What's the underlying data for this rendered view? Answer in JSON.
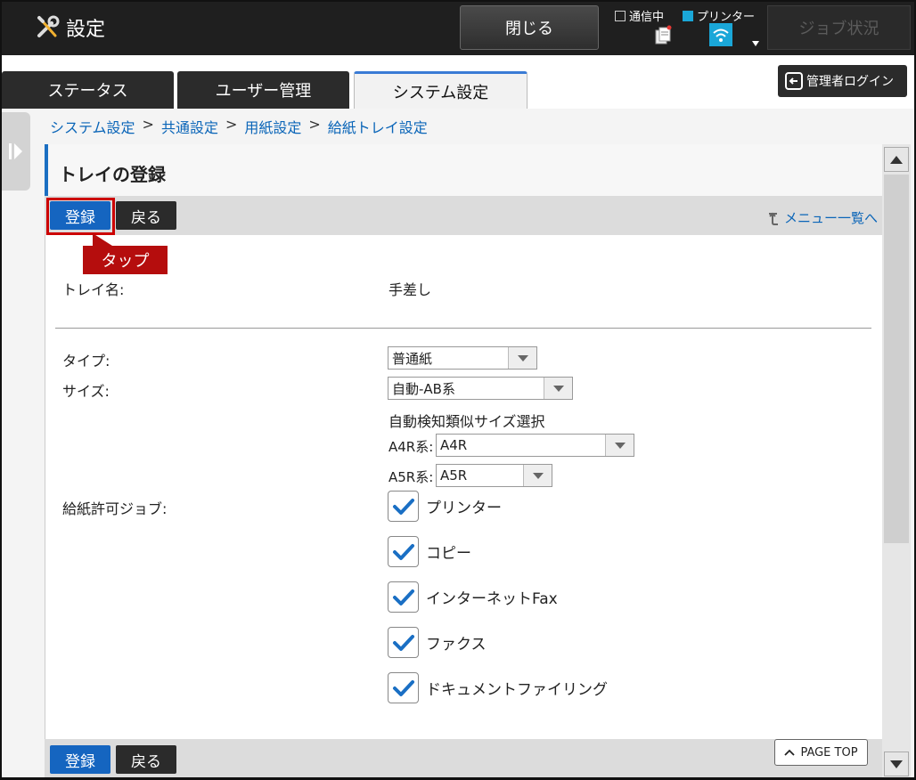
{
  "header": {
    "title": "設定",
    "close_label": "閉じる",
    "status_comm_label": "通信中",
    "status_printer_label": "プリンター",
    "job_status_label": "ジョブ状況"
  },
  "tabs": [
    {
      "label": "ステータス",
      "active": false
    },
    {
      "label": "ユーザー管理",
      "active": false
    },
    {
      "label": "システム設定",
      "active": true
    }
  ],
  "admin_login_label": "管理者ログイン",
  "breadcrumb": [
    "システム設定",
    "共通設定",
    "用紙設定",
    "給紙トレイ設定"
  ],
  "breadcrumb_sep": ">",
  "page_title": "トレイの登録",
  "toolbar": {
    "register_label": "登録",
    "back_label": "戻る",
    "menu_link_label": "メニュー一覧へ"
  },
  "tooltip_text": "タップ",
  "form": {
    "tray_name_label": "トレイ名:",
    "tray_name_value": "手差し",
    "type_label": "タイプ:",
    "type_value": "普通紙",
    "size_label": "サイズ:",
    "size_value": "自動-AB系",
    "auto_detect_label": "自動検知類似サイズ選択",
    "a4r_label": "A4R系:",
    "a4r_value": "A4R",
    "a5r_label": "A5R系:",
    "a5r_value": "A5R",
    "allowed_jobs_label": "給紙許可ジョブ:",
    "jobs": [
      {
        "label": "プリンター",
        "checked": true
      },
      {
        "label": "コピー",
        "checked": true
      },
      {
        "label": "インターネットFax",
        "checked": true
      },
      {
        "label": "ファクス",
        "checked": true
      },
      {
        "label": "ドキュメントファイリング",
        "checked": true
      }
    ]
  },
  "page_top_label": "PAGE TOP",
  "colors": {
    "accent_blue": "#1565c0",
    "link_blue": "#0a65b8",
    "highlight_red": "#b50d0d",
    "check_blue": "#1a6fc4"
  }
}
